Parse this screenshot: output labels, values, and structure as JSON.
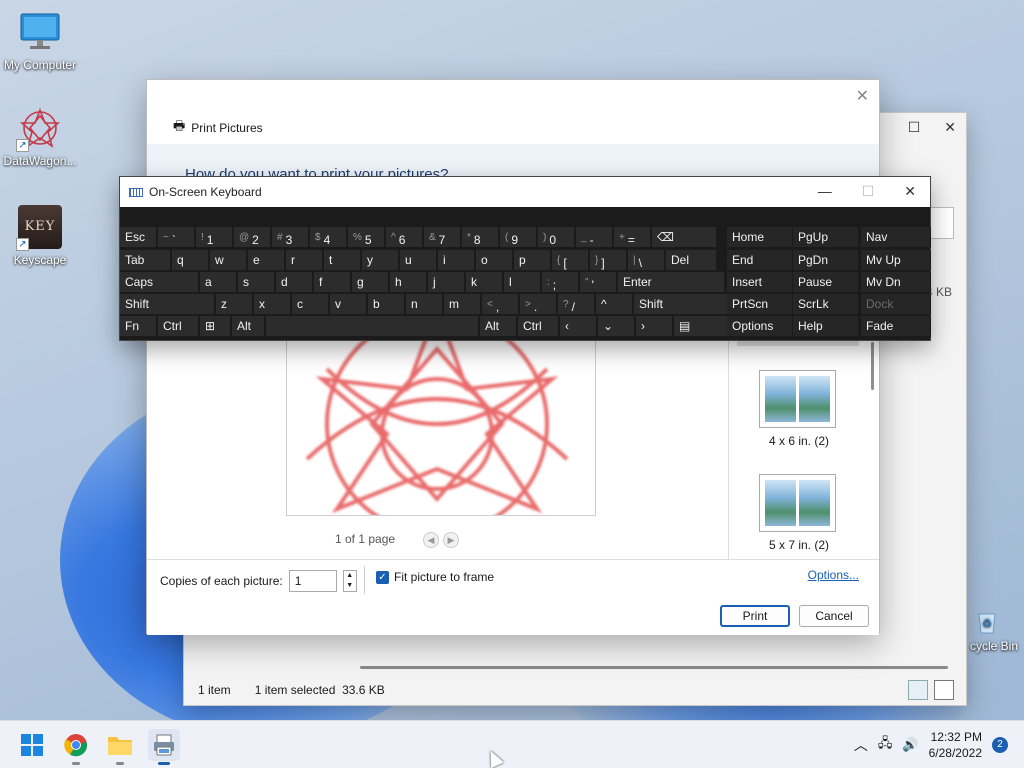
{
  "desktop": {
    "icons": [
      {
        "label": "My Computer",
        "icon": "monitor-icon"
      },
      {
        "label": "DataWagon...",
        "icon": "datawagon-icon"
      },
      {
        "label": "Keyscape",
        "icon": "keyscape-icon",
        "badge_text": "KEY"
      },
      {
        "label": "cycle Bin",
        "icon": "recycle-bin-icon"
      }
    ]
  },
  "explorer": {
    "status_items": "1 item",
    "status_selected": "1 item selected",
    "status_size": "33.6 KB",
    "size_fragment": "4 KB"
  },
  "print_dialog": {
    "title": "Print Pictures",
    "question": "How do you want to print your pictures?",
    "page_info": "1 of 1 page",
    "layouts": [
      {
        "label": "4 x 6 in. (2)"
      },
      {
        "label": "5 x 7 in. (2)"
      }
    ],
    "copies_label": "Copies of each picture:",
    "copies_value": "1",
    "fit_label": "Fit picture to frame",
    "fit_checked": true,
    "options_link": "Options...",
    "print_button": "Print",
    "cancel_button": "Cancel"
  },
  "osk": {
    "title": "On-Screen Keyboard",
    "rows": [
      [
        {
          "l": "Esc"
        },
        {
          "s": "~",
          "l": "`"
        },
        {
          "s": "!",
          "l": "1"
        },
        {
          "s": "@",
          "l": "2"
        },
        {
          "s": "#",
          "l": "3"
        },
        {
          "s": "$",
          "l": "4"
        },
        {
          "s": "%",
          "l": "5"
        },
        {
          "s": "^",
          "l": "6"
        },
        {
          "s": "&",
          "l": "7"
        },
        {
          "s": "*",
          "l": "8"
        },
        {
          "s": "(",
          "l": "9"
        },
        {
          "s": ")",
          "l": "0"
        },
        {
          "s": "_",
          "l": "-"
        },
        {
          "s": "+",
          "l": "="
        },
        {
          "l": "⌫"
        },
        {
          "l": "Home"
        },
        {
          "l": "PgUp"
        },
        {
          "l": "Nav"
        }
      ],
      [
        {
          "l": "Tab"
        },
        {
          "l": "q"
        },
        {
          "l": "w"
        },
        {
          "l": "e"
        },
        {
          "l": "r"
        },
        {
          "l": "t"
        },
        {
          "l": "y"
        },
        {
          "l": "u"
        },
        {
          "l": "i"
        },
        {
          "l": "o"
        },
        {
          "l": "p"
        },
        {
          "s": "{",
          "l": "["
        },
        {
          "s": "}",
          "l": "]"
        },
        {
          "s": "|",
          "l": "\\"
        },
        {
          "l": "Del"
        },
        {
          "l": "End"
        },
        {
          "l": "PgDn"
        },
        {
          "l": "Mv Up"
        }
      ],
      [
        {
          "l": "Caps"
        },
        {
          "l": "a"
        },
        {
          "l": "s"
        },
        {
          "l": "d"
        },
        {
          "l": "f"
        },
        {
          "l": "g"
        },
        {
          "l": "h"
        },
        {
          "l": "j"
        },
        {
          "l": "k"
        },
        {
          "l": "l"
        },
        {
          "s": ":",
          "l": ";"
        },
        {
          "s": "\"",
          "l": "'"
        },
        {
          "l": "Enter"
        },
        {
          "l": "Insert"
        },
        {
          "l": "Pause"
        },
        {
          "l": "Mv Dn"
        }
      ],
      [
        {
          "l": "Shift"
        },
        {
          "l": "z"
        },
        {
          "l": "x"
        },
        {
          "l": "c"
        },
        {
          "l": "v"
        },
        {
          "l": "b"
        },
        {
          "l": "n"
        },
        {
          "l": "m"
        },
        {
          "s": "<",
          "l": ","
        },
        {
          "s": ">",
          "l": "."
        },
        {
          "s": "?",
          "l": "/"
        },
        {
          "l": "^"
        },
        {
          "l": "Shift"
        },
        {
          "l": "PrtScn"
        },
        {
          "l": "ScrLk"
        },
        {
          "l": "Dock",
          "dim": true
        }
      ],
      [
        {
          "l": "Fn"
        },
        {
          "l": "Ctrl"
        },
        {
          "l": "⊞"
        },
        {
          "l": "Alt"
        },
        {
          "l": ""
        },
        {
          "l": "Alt"
        },
        {
          "l": "Ctrl"
        },
        {
          "l": "‹"
        },
        {
          "l": "⌄"
        },
        {
          "l": "›"
        },
        {
          "l": "▤"
        },
        {
          "l": "Options"
        },
        {
          "l": "Help"
        },
        {
          "l": "Fade"
        }
      ]
    ]
  },
  "taskbar": {
    "apps": [
      "start-icon",
      "chrome-icon",
      "file-explorer-icon",
      "print-pictures-icon"
    ],
    "time": "12:32 PM",
    "date": "6/28/2022",
    "notification_count": "2"
  }
}
